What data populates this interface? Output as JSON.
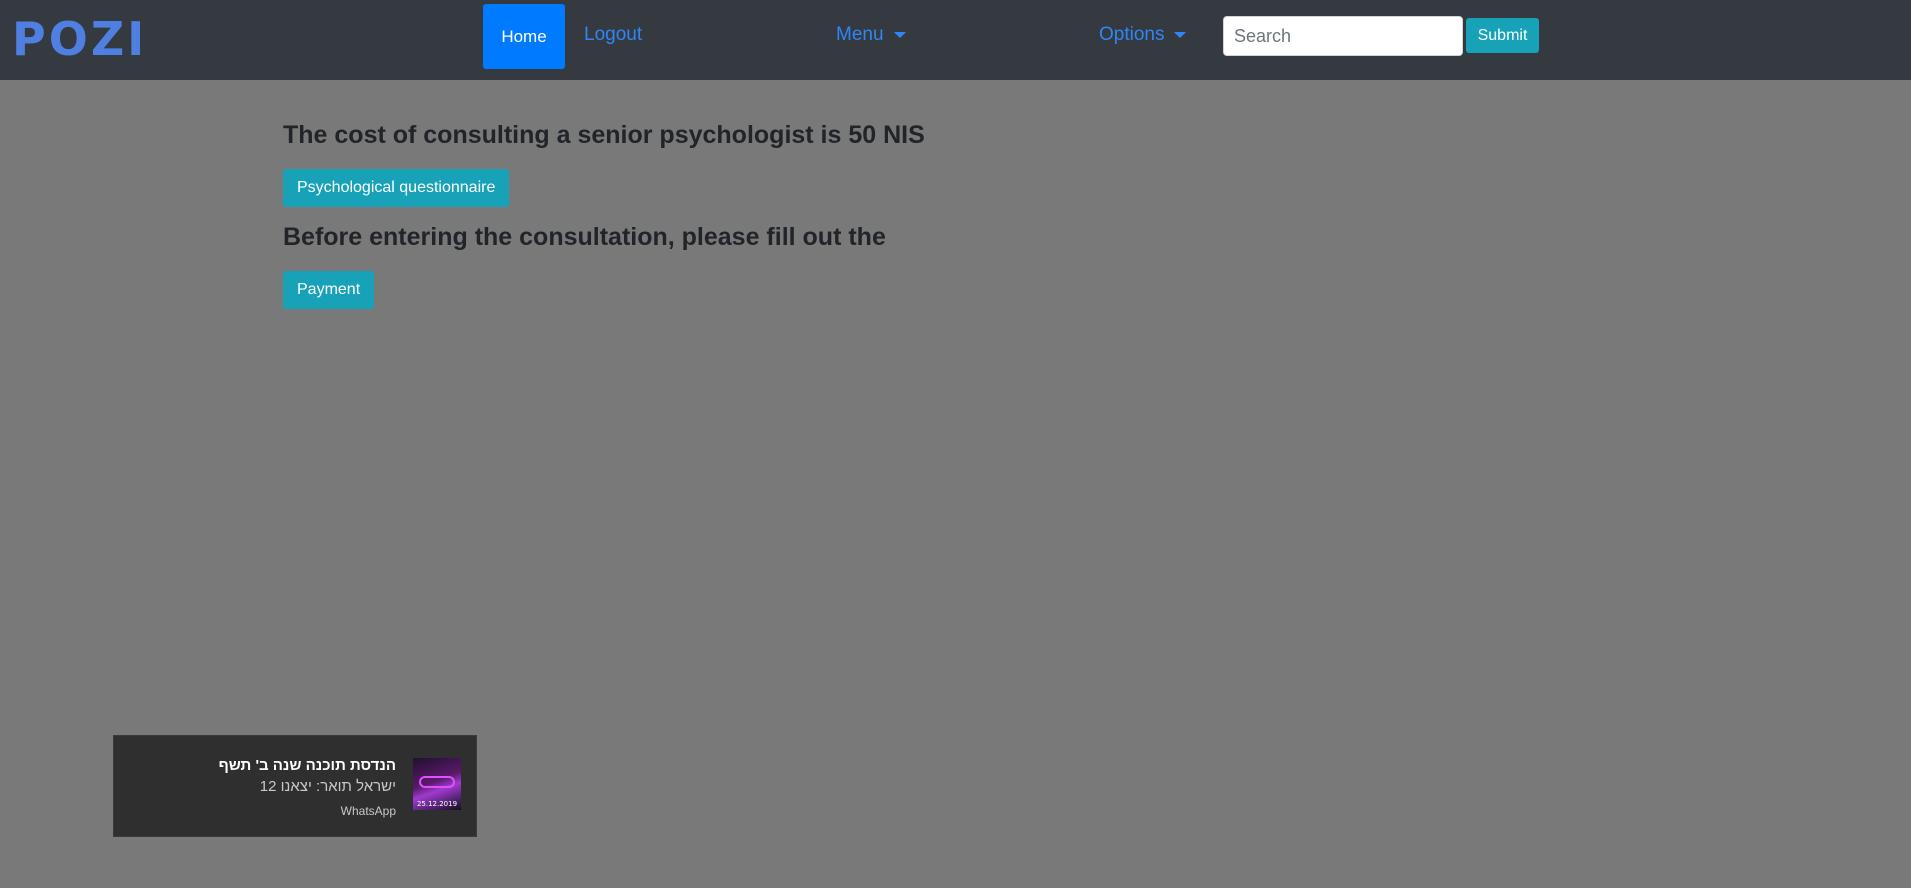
{
  "navbar": {
    "logo": "POZI",
    "home_label": "Home",
    "logout_label": "Logout",
    "menu_label": "Menu",
    "options_label": "Options",
    "search_placeholder": "Search",
    "submit_label": "Submit"
  },
  "main": {
    "cost_heading": "The cost of consulting a senior psychologist is 50 NIS",
    "questionnaire_button": "Psychological questionnaire",
    "instruction_heading": "Before entering the consultation, please fill out the",
    "payment_button": "Payment"
  },
  "notification": {
    "title": "הנדסת תוכנה שנה ב' תשף",
    "message": "ישראל תואר: יצאנו 12",
    "app": "WhatsApp",
    "thumbnail_icon": "group-photo-icon"
  },
  "colors": {
    "navbar_bg": "#343a40",
    "page_bg": "#797979",
    "primary": "#007bff",
    "info": "#17a2b8",
    "link": "#2f86f6"
  }
}
